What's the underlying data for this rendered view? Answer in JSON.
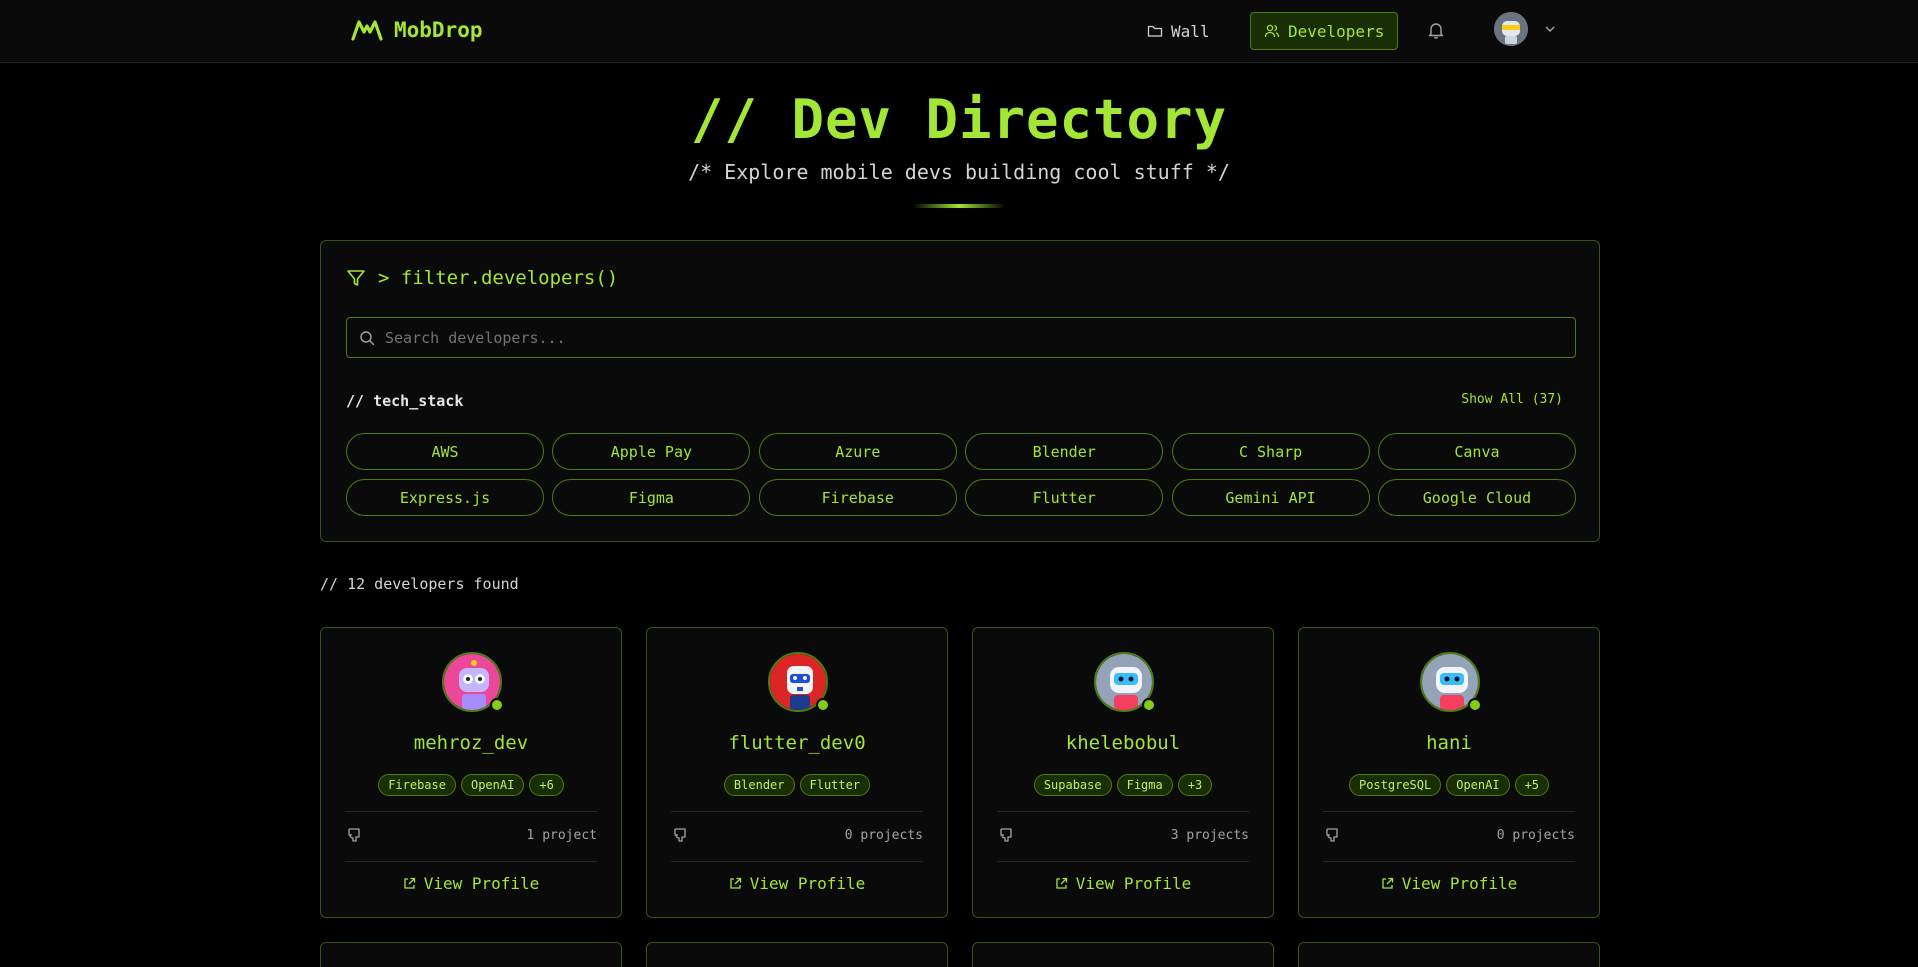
{
  "header": {
    "logo_text": "MobDrop",
    "nav_wall": "Wall",
    "nav_developers": "Developers",
    "accent": "#a3e635"
  },
  "hero": {
    "title": "// Dev Directory",
    "subtitle": "/* Explore mobile devs building cool stuff */"
  },
  "filter": {
    "heading": "> filter.developers()",
    "search_placeholder": "Search developers...",
    "stack_label": "// tech_stack",
    "show_all": "Show All (37)",
    "chips": [
      "AWS",
      "Apple Pay",
      "Azure",
      "Blender",
      "C Sharp",
      "Canva",
      "Express.js",
      "Figma",
      "Firebase",
      "Flutter",
      "Gemini API",
      "Google Cloud"
    ]
  },
  "results": {
    "count_text": "// 12 developers found"
  },
  "cards": [
    {
      "name": "mehroz_dev",
      "tags": [
        "Firebase",
        "OpenAI",
        "+6"
      ],
      "projects": "1 project",
      "cta": "View Profile",
      "avatar_color": "#ec4899"
    },
    {
      "name": "flutter_dev0",
      "tags": [
        "Blender",
        "Flutter"
      ],
      "projects": "0 projects",
      "cta": "View Profile",
      "avatar_color": "#dc2626"
    },
    {
      "name": "khelebobul",
      "tags": [
        "Supabase",
        "Figma",
        "+3"
      ],
      "projects": "3 projects",
      "cta": "View Profile",
      "avatar_color": "#94a3b8"
    },
    {
      "name": "hani",
      "tags": [
        "PostgreSQL",
        "OpenAI",
        "+5"
      ],
      "projects": "0 projects",
      "cta": "View Profile",
      "avatar_color": "#94a3b8"
    }
  ]
}
